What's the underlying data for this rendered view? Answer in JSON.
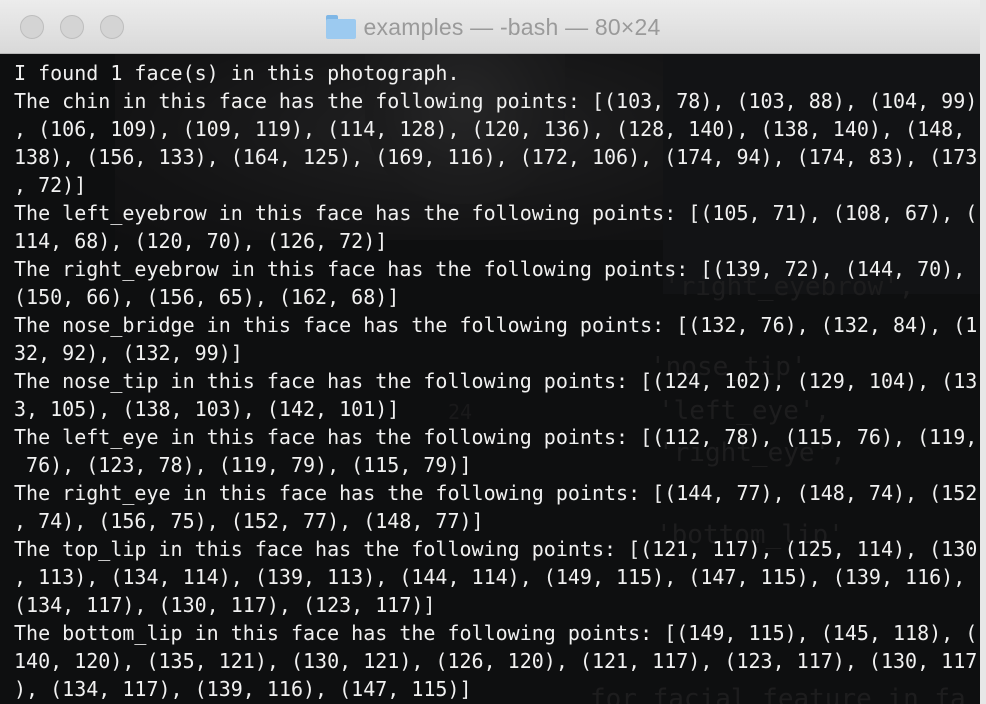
{
  "window": {
    "title": "examples — -bash — 80×24"
  },
  "terminal": {
    "lines": [
      "I found 1 face(s) in this photograph.",
      "The chin in this face has the following points: [(103, 78), (103, 88), (104, 99)",
      ", (106, 109), (109, 119), (114, 128), (120, 136), (128, 140), (138, 140), (148,",
      "138), (156, 133), (164, 125), (169, 116), (172, 106), (174, 94), (174, 83), (173",
      ", 72)]",
      "The left_eyebrow in this face has the following points: [(105, 71), (108, 67), (",
      "114, 68), (120, 70), (126, 72)]",
      "The right_eyebrow in this face has the following points: [(139, 72), (144, 70),",
      "(150, 66), (156, 65), (162, 68)]",
      "The nose_bridge in this face has the following points: [(132, 76), (132, 84), (1",
      "32, 92), (132, 99)]",
      "The nose_tip in this face has the following points: [(124, 102), (129, 104), (13",
      "3, 105), (138, 103), (142, 101)]",
      "The left_eye in this face has the following points: [(112, 78), (115, 76), (119,",
      " 76), (123, 78), (119, 79), (115, 79)]",
      "The right_eye in this face has the following points: [(144, 77), (148, 74), (152",
      ", 74), (156, 75), (152, 77), (148, 77)]",
      "The top_lip in this face has the following points: [(121, 117), (125, 114), (130",
      ", 113), (134, 114), (139, 113), (144, 114), (149, 115), (147, 115), (139, 116),",
      "(134, 117), (130, 117), (123, 117)]",
      "The bottom_lip in this face has the following points: [(149, 115), (145, 118), (",
      "140, 120), (135, 121), (130, 121), (126, 120), (121, 117), (123, 117), (130, 117",
      "), (134, 117), (139, 116), (147, 115)]"
    ]
  },
  "background_editor": {
    "code": [
      "'right_eyebrow',",
      "'nose_tip',",
      "'left_eye',",
      "'right_eye',",
      "'bottom_lip'",
      "for facial_feature in fa"
    ],
    "line_numbers": [
      "24"
    ]
  }
}
